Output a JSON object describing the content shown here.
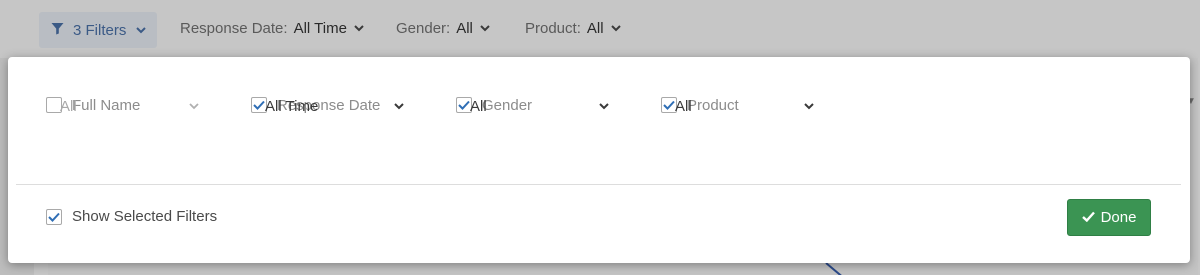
{
  "topbar": {
    "filters_button": {
      "label": "3 Filters",
      "icon": "filter-icon"
    },
    "items": [
      {
        "label": "Response Date:",
        "value": "All Time"
      },
      {
        "label": "Gender:",
        "value": "All"
      },
      {
        "label": "Product:",
        "value": "All"
      }
    ]
  },
  "panel": {
    "fields": [
      {
        "label": "Full Name",
        "checked": false,
        "value": "All"
      },
      {
        "label": "Response Date",
        "checked": true,
        "value": "All Time"
      },
      {
        "label": "Gender",
        "checked": true,
        "value": "All"
      },
      {
        "label": "Product",
        "checked": true,
        "value": "All"
      }
    ],
    "show_selected": {
      "label": "Show Selected Filters",
      "checked": true
    },
    "done_button": {
      "label": "Done",
      "icon": "check-icon"
    }
  },
  "colors": {
    "accent": "#2f6eb5",
    "done_green": "#3b9453",
    "filter_blue": "#3b5a86"
  }
}
